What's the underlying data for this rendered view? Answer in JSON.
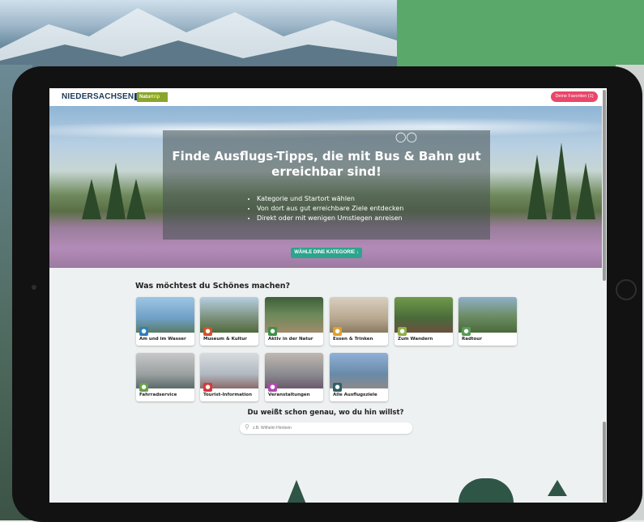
{
  "header": {
    "logo_text": "NIEDERSACHSEN",
    "logo_suffix": "NI",
    "badge_part1": "Natur",
    "badge_part2": "trip",
    "favorites_label": "Deine Favoriten (1)"
  },
  "hero": {
    "title": "Finde Ausflugs-Tipps, die mit Bus & Bahn gut erreichbar sind!",
    "bullets": [
      "Kategorie und Startort wählen",
      "Von dort aus gut erreichbare Ziele entdecken",
      "Direkt oder mit wenigen Umstiegen anreisen"
    ],
    "cta_label": "WÄHLE DINE KATEGORIE ↓"
  },
  "categories": {
    "title": "Was möchtest du Schönes machen?",
    "items": [
      {
        "label": "Am und im Wasser",
        "icon": "water-icon",
        "color": "#2f7fbf"
      },
      {
        "label": "Museum & Kultur",
        "icon": "museum-icon",
        "color": "#d0522d"
      },
      {
        "label": "Aktiv in der Natur",
        "icon": "nature-icon",
        "color": "#3f8f4a"
      },
      {
        "label": "Essen & Trinken",
        "icon": "food-icon",
        "color": "#e0a12c"
      },
      {
        "label": "Zum Wandern",
        "icon": "hiking-icon",
        "color": "#8fb04a"
      },
      {
        "label": "Radtour",
        "icon": "bike-icon",
        "color": "#5a9a5a"
      },
      {
        "label": "Fahrradservice",
        "icon": "bike-service-icon",
        "color": "#6aa04a"
      },
      {
        "label": "Tourist-Information",
        "icon": "info-icon",
        "color": "#d63a3a"
      },
      {
        "label": "Veranstaltungen",
        "icon": "event-icon",
        "color": "#b04ab0"
      },
      {
        "label": "Alle Ausflugsziele",
        "icon": "compass-icon",
        "color": "#2f5f6a"
      }
    ]
  },
  "search": {
    "title": "Du weißt schon genau, wo du hin willst?",
    "placeholder": "z.B. Wilhelm Hirnbein"
  }
}
